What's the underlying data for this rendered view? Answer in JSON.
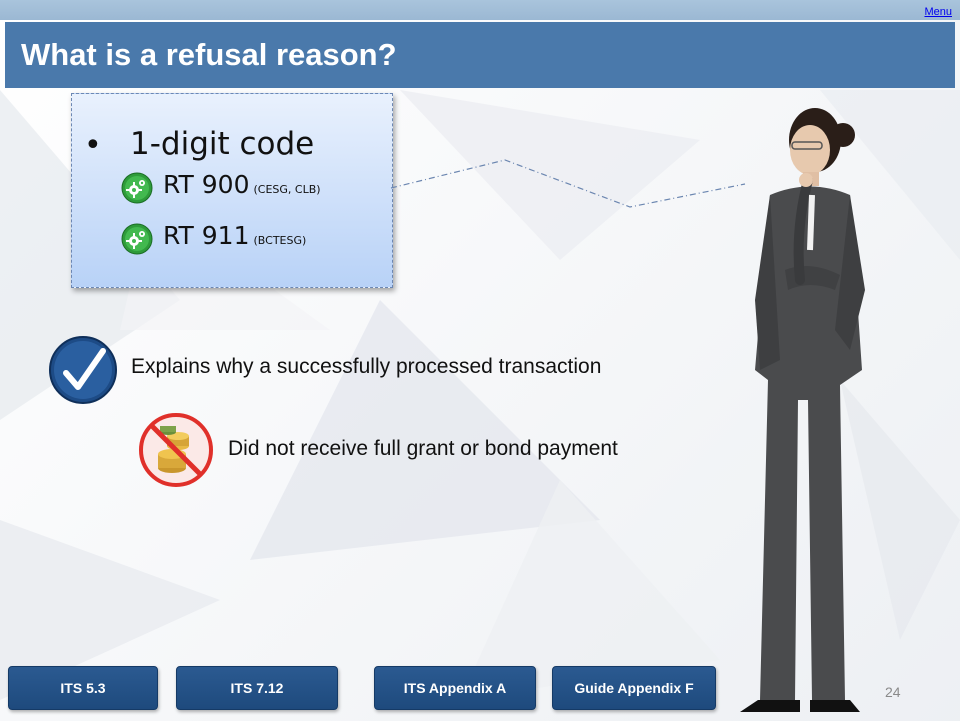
{
  "header": {
    "menu_label": "Menu",
    "title": "What is a refusal reason?"
  },
  "info_box": {
    "bullet": "1-digit code",
    "codes": [
      {
        "code": "RT 900",
        "programs": "(CESG, CLB)",
        "icon": "gear-icon"
      },
      {
        "code": "RT 911",
        "programs": "(BCTESG)",
        "icon": "gear-icon"
      }
    ]
  },
  "points": {
    "explains": "Explains why a successfully processed transaction",
    "did_not": "Did not receive full grant or bond payment"
  },
  "nav": {
    "buttons": [
      "ITS 5.3",
      "ITS 7.12",
      "ITS Appendix A",
      "Guide Appendix F"
    ]
  },
  "page_number": "24",
  "colors": {
    "title_bar": "#4a79ab",
    "nav_button": "#254f85",
    "infobox_gradient_top": "#e9f1fd",
    "infobox_gradient_bottom": "#b8d2f7"
  }
}
